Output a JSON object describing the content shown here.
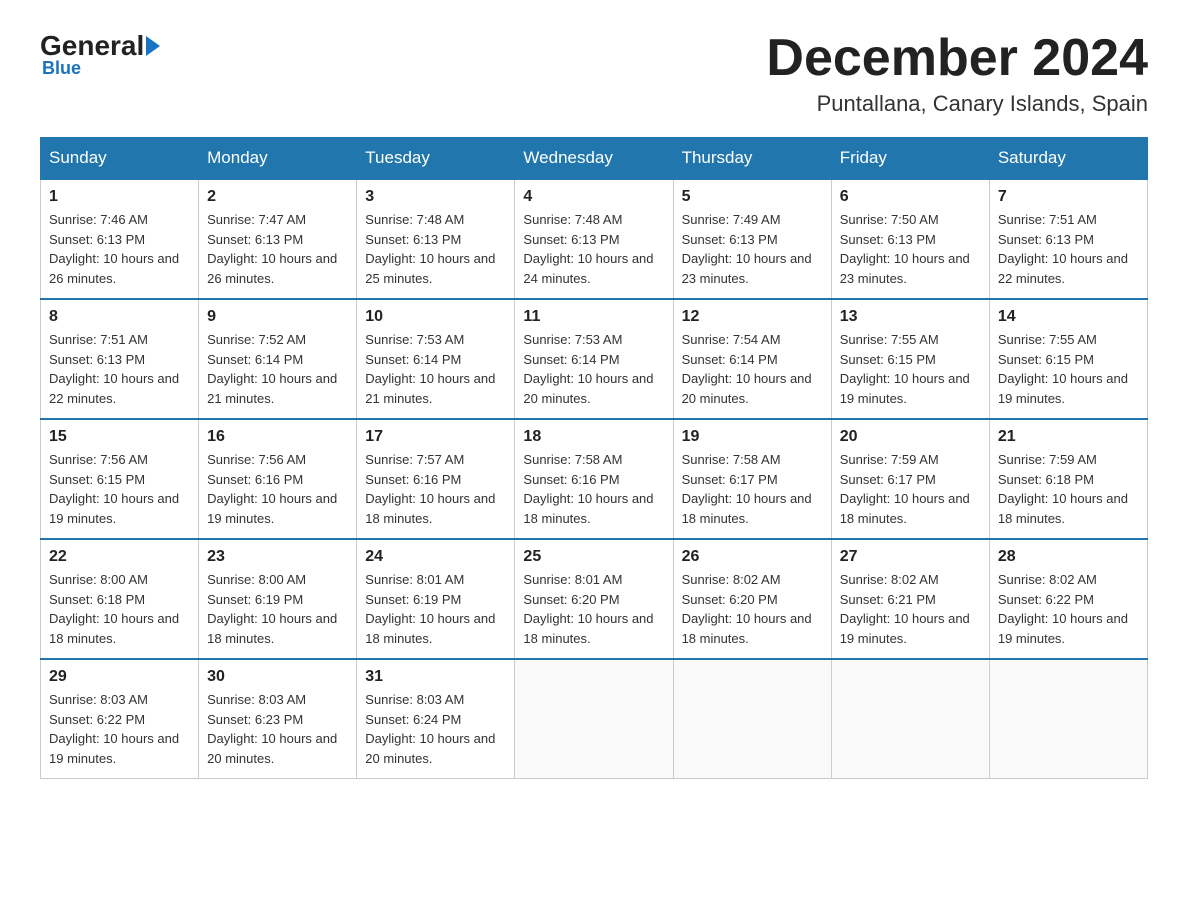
{
  "header": {
    "logo_general": "General",
    "logo_blue": "Blue",
    "month_title": "December 2024",
    "subtitle": "Puntallana, Canary Islands, Spain"
  },
  "days_of_week": [
    "Sunday",
    "Monday",
    "Tuesday",
    "Wednesday",
    "Thursday",
    "Friday",
    "Saturday"
  ],
  "weeks": [
    [
      {
        "day": "1",
        "sunrise": "7:46 AM",
        "sunset": "6:13 PM",
        "daylight": "10 hours and 26 minutes."
      },
      {
        "day": "2",
        "sunrise": "7:47 AM",
        "sunset": "6:13 PM",
        "daylight": "10 hours and 26 minutes."
      },
      {
        "day": "3",
        "sunrise": "7:48 AM",
        "sunset": "6:13 PM",
        "daylight": "10 hours and 25 minutes."
      },
      {
        "day": "4",
        "sunrise": "7:48 AM",
        "sunset": "6:13 PM",
        "daylight": "10 hours and 24 minutes."
      },
      {
        "day": "5",
        "sunrise": "7:49 AM",
        "sunset": "6:13 PM",
        "daylight": "10 hours and 23 minutes."
      },
      {
        "day": "6",
        "sunrise": "7:50 AM",
        "sunset": "6:13 PM",
        "daylight": "10 hours and 23 minutes."
      },
      {
        "day": "7",
        "sunrise": "7:51 AM",
        "sunset": "6:13 PM",
        "daylight": "10 hours and 22 minutes."
      }
    ],
    [
      {
        "day": "8",
        "sunrise": "7:51 AM",
        "sunset": "6:13 PM",
        "daylight": "10 hours and 22 minutes."
      },
      {
        "day": "9",
        "sunrise": "7:52 AM",
        "sunset": "6:14 PM",
        "daylight": "10 hours and 21 minutes."
      },
      {
        "day": "10",
        "sunrise": "7:53 AM",
        "sunset": "6:14 PM",
        "daylight": "10 hours and 21 minutes."
      },
      {
        "day": "11",
        "sunrise": "7:53 AM",
        "sunset": "6:14 PM",
        "daylight": "10 hours and 20 minutes."
      },
      {
        "day": "12",
        "sunrise": "7:54 AM",
        "sunset": "6:14 PM",
        "daylight": "10 hours and 20 minutes."
      },
      {
        "day": "13",
        "sunrise": "7:55 AM",
        "sunset": "6:15 PM",
        "daylight": "10 hours and 19 minutes."
      },
      {
        "day": "14",
        "sunrise": "7:55 AM",
        "sunset": "6:15 PM",
        "daylight": "10 hours and 19 minutes."
      }
    ],
    [
      {
        "day": "15",
        "sunrise": "7:56 AM",
        "sunset": "6:15 PM",
        "daylight": "10 hours and 19 minutes."
      },
      {
        "day": "16",
        "sunrise": "7:56 AM",
        "sunset": "6:16 PM",
        "daylight": "10 hours and 19 minutes."
      },
      {
        "day": "17",
        "sunrise": "7:57 AM",
        "sunset": "6:16 PM",
        "daylight": "10 hours and 18 minutes."
      },
      {
        "day": "18",
        "sunrise": "7:58 AM",
        "sunset": "6:16 PM",
        "daylight": "10 hours and 18 minutes."
      },
      {
        "day": "19",
        "sunrise": "7:58 AM",
        "sunset": "6:17 PM",
        "daylight": "10 hours and 18 minutes."
      },
      {
        "day": "20",
        "sunrise": "7:59 AM",
        "sunset": "6:17 PM",
        "daylight": "10 hours and 18 minutes."
      },
      {
        "day": "21",
        "sunrise": "7:59 AM",
        "sunset": "6:18 PM",
        "daylight": "10 hours and 18 minutes."
      }
    ],
    [
      {
        "day": "22",
        "sunrise": "8:00 AM",
        "sunset": "6:18 PM",
        "daylight": "10 hours and 18 minutes."
      },
      {
        "day": "23",
        "sunrise": "8:00 AM",
        "sunset": "6:19 PM",
        "daylight": "10 hours and 18 minutes."
      },
      {
        "day": "24",
        "sunrise": "8:01 AM",
        "sunset": "6:19 PM",
        "daylight": "10 hours and 18 minutes."
      },
      {
        "day": "25",
        "sunrise": "8:01 AM",
        "sunset": "6:20 PM",
        "daylight": "10 hours and 18 minutes."
      },
      {
        "day": "26",
        "sunrise": "8:02 AM",
        "sunset": "6:20 PM",
        "daylight": "10 hours and 18 minutes."
      },
      {
        "day": "27",
        "sunrise": "8:02 AM",
        "sunset": "6:21 PM",
        "daylight": "10 hours and 19 minutes."
      },
      {
        "day": "28",
        "sunrise": "8:02 AM",
        "sunset": "6:22 PM",
        "daylight": "10 hours and 19 minutes."
      }
    ],
    [
      {
        "day": "29",
        "sunrise": "8:03 AM",
        "sunset": "6:22 PM",
        "daylight": "10 hours and 19 minutes."
      },
      {
        "day": "30",
        "sunrise": "8:03 AM",
        "sunset": "6:23 PM",
        "daylight": "10 hours and 20 minutes."
      },
      {
        "day": "31",
        "sunrise": "8:03 AM",
        "sunset": "6:24 PM",
        "daylight": "10 hours and 20 minutes."
      },
      null,
      null,
      null,
      null
    ]
  ]
}
